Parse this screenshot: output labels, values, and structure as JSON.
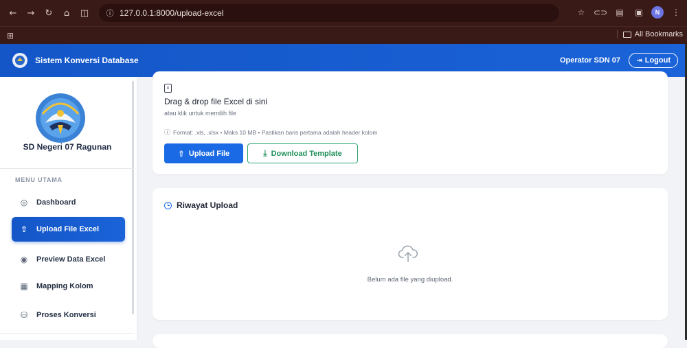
{
  "browser": {
    "url": "127.0.0.1:8000/upload-excel",
    "bookmarks_label": "All Bookmarks",
    "profile_initial": "N"
  },
  "header": {
    "title": "Sistem Konversi Database",
    "user": "Operator SDN 07",
    "logout_label": "Logout",
    "brand_color": "#1456c8"
  },
  "sidebar": {
    "school_name": "SD Negeri 07 Ragunan",
    "section_label": "MENU UTAMA",
    "items": [
      {
        "label": "Dashboard",
        "icon": "dashboard-icon",
        "active": false
      },
      {
        "label": "Upload File Excel",
        "icon": "upload-icon",
        "active": true
      },
      {
        "label": "Preview Data Excel",
        "icon": "eye-icon",
        "active": false
      },
      {
        "label": "Mapping Kolom",
        "icon": "table-icon",
        "active": false
      },
      {
        "label": "Proses Konversi",
        "icon": "database-icon",
        "active": false
      }
    ]
  },
  "upload_card": {
    "title": "Drag & drop file Excel di sini",
    "subtitle": "atau klik untuk memilih file",
    "info": "Format: .xls, .xlsx • Maks 10 MB • Pastikan baris pertama adalah header kolom",
    "upload_button": "Upload File",
    "template_button": "Download Template"
  },
  "history_card": {
    "title": "Riwayat Upload",
    "empty_message": "Belum ada file yang diupload."
  }
}
